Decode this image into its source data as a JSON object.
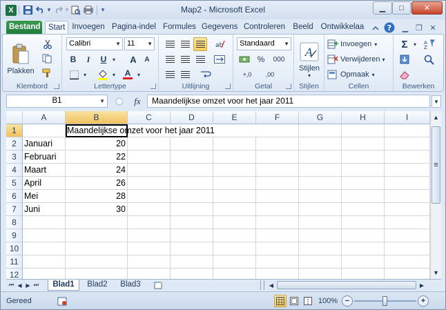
{
  "window": {
    "title": "Map2 - Microsoft Excel",
    "controls": {
      "minimize": "▁",
      "maximize": "□",
      "close": "✕"
    }
  },
  "qat": {
    "app_icon": "X",
    "undo_dropdown": "▾",
    "customize": "▾"
  },
  "tabs": [
    {
      "label": "Bestand"
    },
    {
      "label": "Start"
    },
    {
      "label": "Invoegen"
    },
    {
      "label": "Pagina-indel"
    },
    {
      "label": "Formules"
    },
    {
      "label": "Gegevens"
    },
    {
      "label": "Controleren"
    },
    {
      "label": "Beeld"
    },
    {
      "label": "Ontwikkelaa"
    }
  ],
  "ribbon": {
    "clipboard": {
      "label": "Klembord",
      "paste": "Plakken"
    },
    "font": {
      "label": "Lettertype",
      "name": "Calibri",
      "size": "11",
      "bold": "B",
      "italic": "I",
      "underline": "U",
      "grow": "A",
      "shrink": "A",
      "fontcolor": "A"
    },
    "alignment": {
      "label": "Uitlijning"
    },
    "number": {
      "label": "Getal",
      "format": "Standaard",
      "percent": "%",
      "thousands": "000",
      "inc": "+,0",
      "dec": ",00"
    },
    "styles": {
      "label": "Stijlen",
      "button": "Stijlen"
    },
    "cells": {
      "label": "Cellen",
      "insert": "Invoegen",
      "delete": "Verwijderen",
      "format": "Opmaak"
    },
    "editing": {
      "label": "Bewerken",
      "sum": "Σ"
    }
  },
  "formula_bar": {
    "namebox": "B1",
    "fx": "fx",
    "content": "Maandelijkse omzet voor het jaar 2011"
  },
  "grid": {
    "columns": [
      "A",
      "B",
      "C",
      "D",
      "E",
      "F",
      "G",
      "H",
      "I"
    ],
    "rows": [
      "1",
      "2",
      "3",
      "4",
      "5",
      "6",
      "7",
      "8",
      "9",
      "10",
      "11",
      "12"
    ],
    "title_cell": "Maandelijkse omzet voor het jaar 2011",
    "data": [
      {
        "month": "Januari",
        "value": "20"
      },
      {
        "month": "Februari",
        "value": "22"
      },
      {
        "month": "Maart",
        "value": "24"
      },
      {
        "month": "April",
        "value": "26"
      },
      {
        "month": "Mei",
        "value": "28"
      },
      {
        "month": "Juni",
        "value": "30"
      }
    ]
  },
  "sheets": [
    {
      "label": "Blad1"
    },
    {
      "label": "Blad2"
    },
    {
      "label": "Blad3"
    }
  ],
  "status": {
    "mode": "Gereed",
    "zoom": "100%",
    "zoom_out": "−",
    "zoom_in": "+"
  }
}
